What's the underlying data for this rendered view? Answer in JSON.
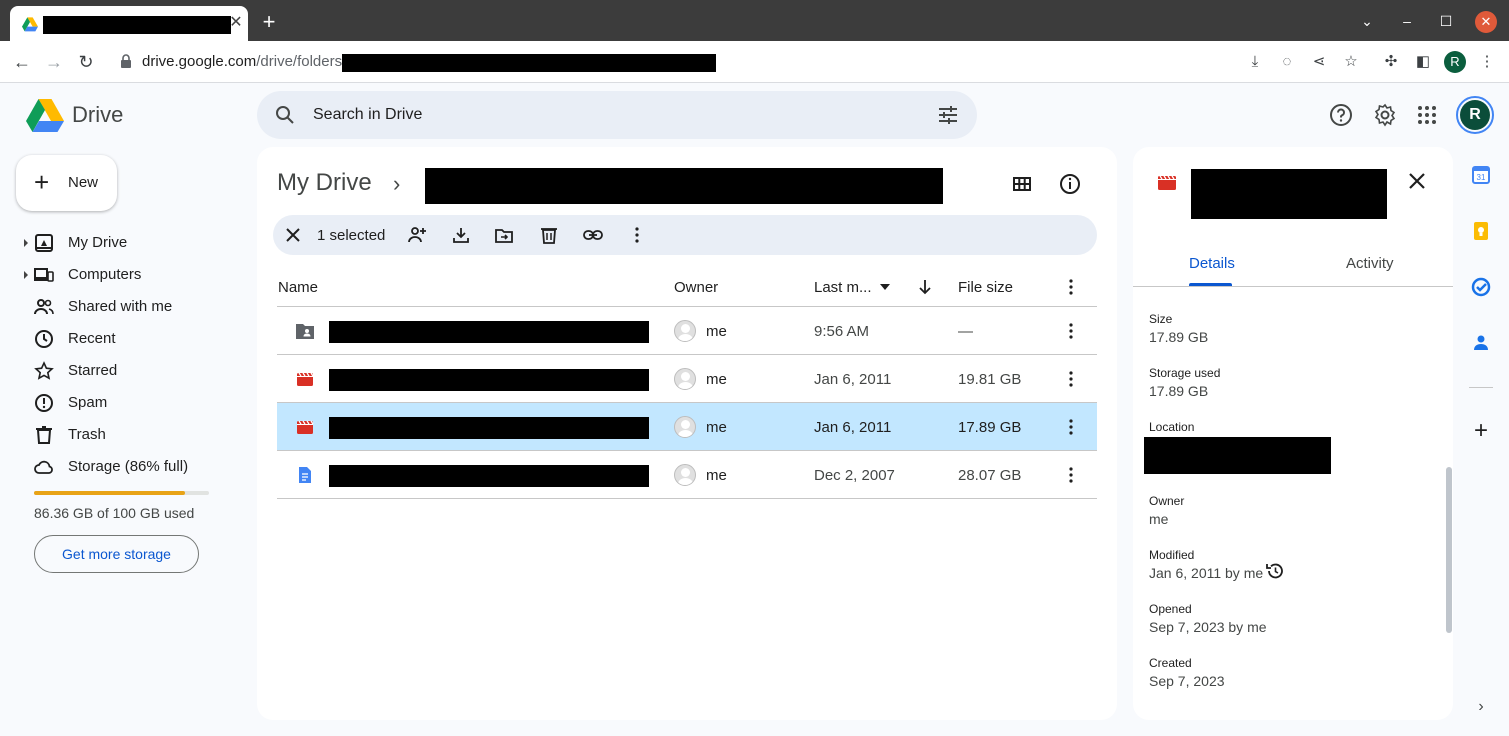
{
  "browser": {
    "url_host": "drive.google.com",
    "url_path": "/drive/folders/",
    "new_tab_label": "+",
    "profile_initial": "R"
  },
  "app": {
    "title": "Drive",
    "search_placeholder": "Search in Drive",
    "avatar_initial": "R"
  },
  "sidebar": {
    "new_label": "New",
    "items": [
      {
        "label": "My Drive",
        "icon": "my-drive-icon"
      },
      {
        "label": "Computers",
        "icon": "computers-icon"
      },
      {
        "label": "Shared with me",
        "icon": "shared-icon"
      },
      {
        "label": "Recent",
        "icon": "clock-icon"
      },
      {
        "label": "Starred",
        "icon": "star-icon"
      },
      {
        "label": "Spam",
        "icon": "spam-icon"
      },
      {
        "label": "Trash",
        "icon": "trash-icon"
      },
      {
        "label": "Storage (86% full)",
        "icon": "cloud-icon"
      }
    ],
    "storage_fraction": 0.86,
    "storage_text": "86.36 GB of 100 GB used",
    "more_storage_label": "Get more storage"
  },
  "main": {
    "breadcrumb_root": "My Drive",
    "breadcrumb_sep": "›",
    "selection_count": "1 selected",
    "columns": {
      "name": "Name",
      "owner": "Owner",
      "modified": "Last m...",
      "size": "File size"
    },
    "rows": [
      {
        "type": "shared-folder",
        "owner": "me",
        "modified": "9:56 AM",
        "size": "—",
        "selected": false
      },
      {
        "type": "video",
        "owner": "me",
        "modified": "Jan 6, 2011",
        "size": "19.81 GB",
        "selected": false
      },
      {
        "type": "video",
        "owner": "me",
        "modified": "Jan 6, 2011",
        "size": "17.89 GB",
        "selected": true
      },
      {
        "type": "doc",
        "owner": "me",
        "modified": "Dec 2, 2007",
        "size": "28.07 GB",
        "selected": false
      }
    ]
  },
  "details": {
    "tabs": {
      "details": "Details",
      "activity": "Activity"
    },
    "size_label": "Size",
    "size_value": "17.89 GB",
    "storage_label": "Storage used",
    "storage_value": "17.89 GB",
    "location_label": "Location",
    "owner_label": "Owner",
    "owner_value": "me",
    "modified_label": "Modified",
    "modified_value": "Jan 6, 2011 by me",
    "opened_label": "Opened",
    "opened_value": "Sep 7, 2023 by me",
    "created_label": "Created",
    "created_value": "Sep 7, 2023"
  },
  "colors": {
    "accent": "#0b57d0",
    "selected_row": "#c2e7ff",
    "storage_bar": "#e8a317",
    "video_icon": "#d93025",
    "doc_icon": "#4285f4"
  }
}
